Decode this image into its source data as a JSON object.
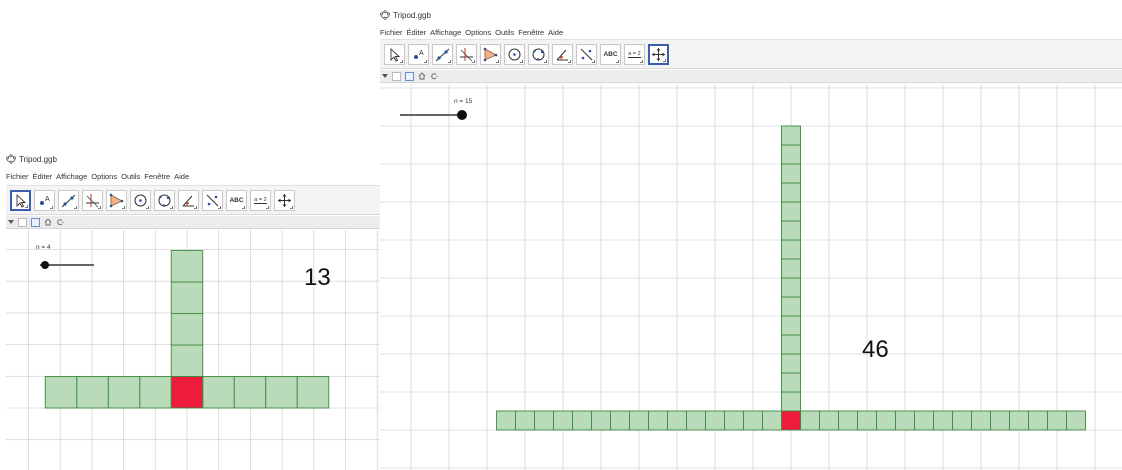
{
  "windows": [
    {
      "id": "small",
      "title": "Tripod.ggb",
      "menu": [
        "Fichier",
        "Éditer",
        "Affichage",
        "Options",
        "Outils",
        "Fenêtre",
        "Aide"
      ],
      "tools": [
        {
          "icon": "move-arrow-icon",
          "label": "",
          "active": true
        },
        {
          "icon": "point-icon",
          "label": "",
          "active": false
        },
        {
          "icon": "line-icon",
          "label": "",
          "active": false
        },
        {
          "icon": "perpendicular-line-icon",
          "label": "",
          "active": false
        },
        {
          "icon": "polygon-icon",
          "label": "",
          "active": false
        },
        {
          "icon": "circle-icon",
          "label": "",
          "active": false
        },
        {
          "icon": "conic-icon",
          "label": "",
          "active": false
        },
        {
          "icon": "angle-icon",
          "label": "",
          "active": false
        },
        {
          "icon": "reflect-icon",
          "label": "",
          "active": false
        },
        {
          "icon": "text-tool-icon",
          "label": "ABC",
          "active": false
        },
        {
          "icon": "slider-tool-icon",
          "label": "a = 2",
          "active": false
        },
        {
          "icon": "move-view-icon",
          "label": "",
          "active": false
        }
      ],
      "slider": {
        "label": "n = 4",
        "value": 4,
        "min": 1,
        "max": 15
      },
      "count_text": "13",
      "tripod": {
        "arm_length": 4,
        "total_cells": 13
      },
      "colors": {
        "cell_fill": "#b9dbb9",
        "cell_border": "#3d8a3d",
        "center_fill": "#ee1c3c",
        "grid": "#d6d6d6"
      }
    },
    {
      "id": "large",
      "title": "Tripod.ggb",
      "menu": [
        "Fichier",
        "Éditer",
        "Affichage",
        "Options",
        "Outils",
        "Fenêtre",
        "Aide"
      ],
      "tools": [
        {
          "icon": "move-arrow-icon",
          "label": "",
          "active": false
        },
        {
          "icon": "point-icon",
          "label": "",
          "active": false
        },
        {
          "icon": "line-icon",
          "label": "",
          "active": false
        },
        {
          "icon": "perpendicular-line-icon",
          "label": "",
          "active": false
        },
        {
          "icon": "polygon-icon",
          "label": "",
          "active": false
        },
        {
          "icon": "circle-icon",
          "label": "",
          "active": false
        },
        {
          "icon": "conic-icon",
          "label": "",
          "active": false
        },
        {
          "icon": "angle-icon",
          "label": "",
          "active": false
        },
        {
          "icon": "reflect-icon",
          "label": "",
          "active": false
        },
        {
          "icon": "text-tool-icon",
          "label": "ABC",
          "active": false
        },
        {
          "icon": "slider-tool-icon",
          "label": "a = 2",
          "active": false
        },
        {
          "icon": "move-view-icon",
          "label": "",
          "active": true
        }
      ],
      "slider": {
        "label": "n = 15",
        "value": 15,
        "min": 1,
        "max": 15
      },
      "count_text": "46",
      "tripod": {
        "arm_length": 15,
        "total_cells": 46
      },
      "colors": {
        "cell_fill": "#b9dbb9",
        "cell_border": "#3d8a3d",
        "center_fill": "#ee1c3c",
        "grid": "#d6d6d6"
      }
    }
  ]
}
